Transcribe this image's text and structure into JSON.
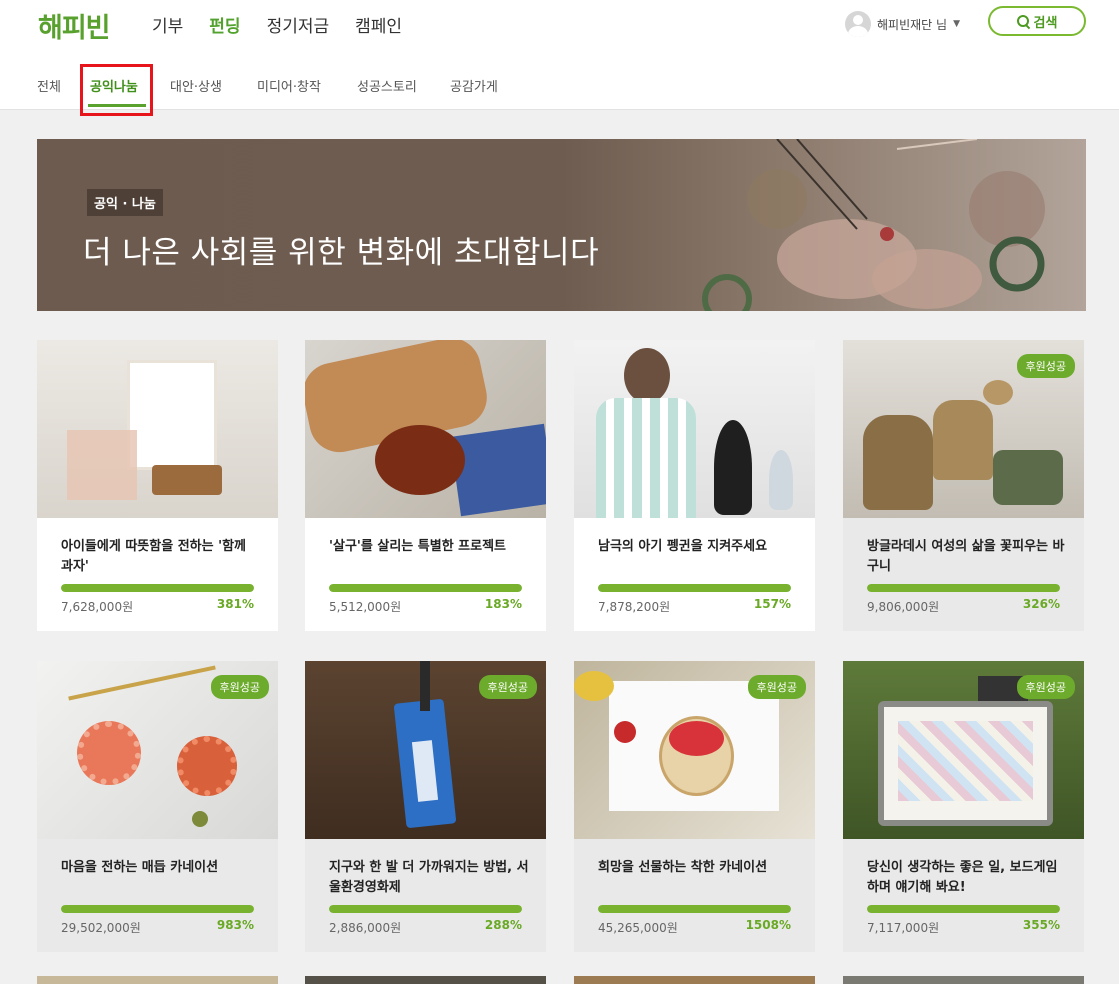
{
  "header": {
    "logo": "해피빈",
    "nav": [
      "기부",
      "펀딩",
      "정기저금",
      "캠페인"
    ],
    "active_nav": "펀딩",
    "user_name": "해피빈재단 님",
    "search_label": "검색"
  },
  "subnav": {
    "items": [
      "전체",
      "공익나눔",
      "대안·상생",
      "미디어·창작",
      "성공스토리",
      "공감가게"
    ],
    "active": "공익나눔"
  },
  "banner": {
    "tag": "공익 · 나눔",
    "title": "더 나은 사회를 위한 변화에 초대합니다"
  },
  "projects": [
    {
      "title": "아이들에게 따뜻함을 전하는 '함께 과자'",
      "amount": "7,628,000원",
      "percent": "381%",
      "badge": "",
      "progress": 100
    },
    {
      "title": "'살구'를 살리는 특별한 프로젝트",
      "amount": "5,512,000원",
      "percent": "183%",
      "badge": "",
      "progress": 100
    },
    {
      "title": "남극의 아기 펭귄을 지켜주세요",
      "amount": "7,878,200원",
      "percent": "157%",
      "badge": "",
      "progress": 100
    },
    {
      "title": "방글라데시 여성의 삶을 꽃피우는 바구니",
      "amount": "9,806,000원",
      "percent": "326%",
      "badge": "후원성공",
      "progress": 100
    },
    {
      "title": "마음을 전하는 매듭 카네이션",
      "amount": "29,502,000원",
      "percent": "983%",
      "badge": "후원성공",
      "progress": 100
    },
    {
      "title": "지구와 한 발 더 가까워지는 방법, 서울환경영화제",
      "amount": "2,886,000원",
      "percent": "288%",
      "badge": "후원성공",
      "progress": 100
    },
    {
      "title": "희망을 선물하는 착한 카네이션",
      "amount": "45,265,000원",
      "percent": "1508%",
      "badge": "후원성공",
      "progress": 100
    },
    {
      "title": "당신이 생각하는 좋은 일, 보드게임하며 얘기해 봐요!",
      "amount": "7,117,000원",
      "percent": "355%",
      "badge": "후원성공",
      "progress": 100
    }
  ],
  "colors": {
    "brand": "#59a12e",
    "progress": "#78b22e",
    "badge": "#6dab2d",
    "highlight": "#e8141b"
  }
}
